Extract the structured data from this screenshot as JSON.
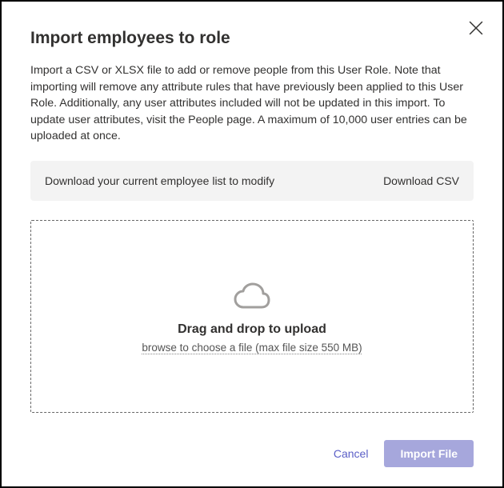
{
  "dialog": {
    "title": "Import employees to role",
    "description": "Import a CSV or XLSX file to add or remove people from this User Role. Note that importing will remove any attribute rules that have previously been applied to this User Role. Additionally, any user attributes included will not be updated in this import. To update user attributes, visit the People page. A maximum of 10,000 user entries can be uploaded at once."
  },
  "download": {
    "prompt": "Download your current employee list to modify",
    "link_label": "Download CSV"
  },
  "dropzone": {
    "headline": "Drag and drop to upload",
    "subtext": "browse to choose a file (max file size 550 MB)"
  },
  "footer": {
    "cancel_label": "Cancel",
    "import_label": "Import File"
  }
}
